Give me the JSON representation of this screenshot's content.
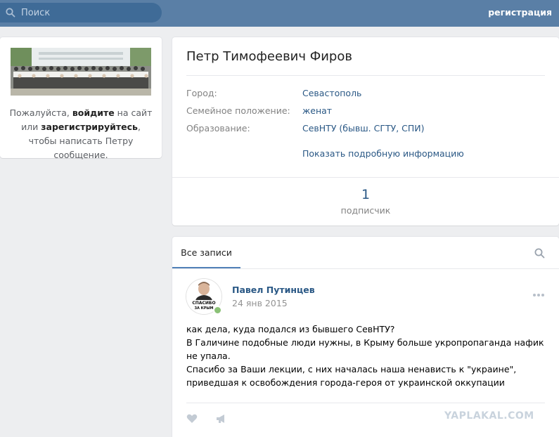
{
  "header": {
    "search_placeholder": "Поиск",
    "register_label": "регистрация"
  },
  "sidebar": {
    "msg_part1": "Пожалуйста, ",
    "msg_login": "войдите",
    "msg_part2": " на сайт или ",
    "msg_register": "зарегистрируйтесь",
    "msg_part3": ", чтобы написать Петру сообщение."
  },
  "profile": {
    "name": "Петр Тимофеевич Фиров",
    "city_label": "Город:",
    "city_value": "Севастополь",
    "family_label": "Семейное положение:",
    "family_value": "женат",
    "education_label": "Образование:",
    "education_value": "СевНТУ (бывш. СГТУ, СПИ)",
    "more_link": "Показать подробную информацию",
    "followers_count": "1",
    "followers_caption": "подписчик"
  },
  "wall": {
    "tab_label": "Все записи",
    "post": {
      "author": "Павел Путинцев",
      "date": "24 янв 2015",
      "avatar_caption": "СПАСИБО ЗА КРЫМ",
      "lines": [
        "как дела, куда подался из бывшего СевНТУ?",
        "В Галичине подобные люди нужны, в Крыму больше укропропаганда нафик не упала.",
        "Спасибо за Ваши лекции, с них началась наша ненависть к \"украине\", приведшая к освобождения города-героя от украинской оккупации"
      ]
    }
  },
  "watermark": "YAPLAKAL.COM",
  "colors": {
    "header_bg": "#5a7fa6",
    "link": "#2a5885",
    "page_bg": "#edeef0"
  }
}
